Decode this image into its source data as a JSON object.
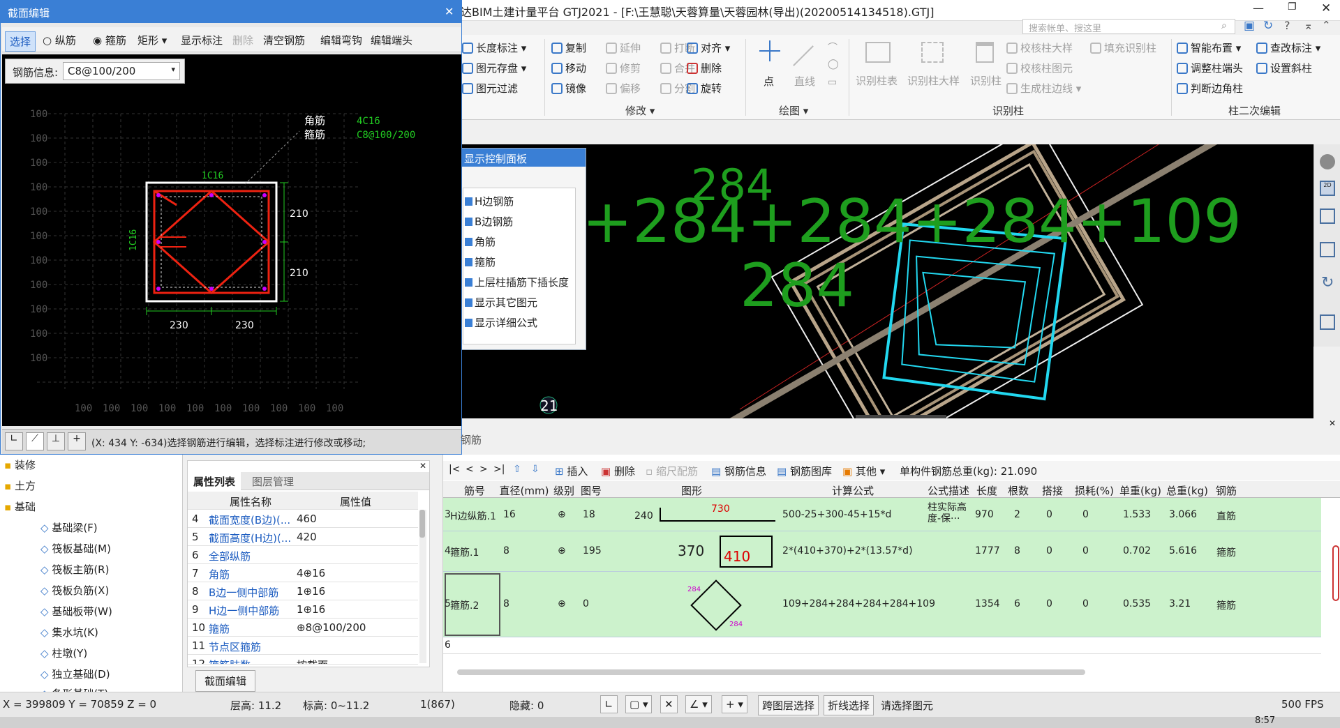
{
  "app": {
    "title": "达BIM土建计量平台 GTJ2021 - [F:\\王慧聪\\天蓉算量\\天蓉园林(导出)(20200514134518).GTJ]",
    "search_placeholder": "搜索帐单、搜这里"
  },
  "ribbon": {
    "col1": [
      "长度标注",
      "图元存盘",
      "图元过滤"
    ],
    "col2": [
      "复制",
      "移动",
      "镜像"
    ],
    "col3": [
      "延伸",
      "修剪",
      "偏移"
    ],
    "col4": [
      "打断",
      "合并",
      "分割"
    ],
    "col5": [
      "对齐",
      "删除",
      "旋转"
    ],
    "modify_group": "修改",
    "draw_items": [
      "点",
      "直线"
    ],
    "draw_group": "绘图",
    "recognize_items": [
      "识别柱表",
      "识别柱大样",
      "识别柱"
    ],
    "recognize_small": [
      "校核柱大样",
      "填充识别柱",
      "校核柱图元",
      "生成柱边线"
    ],
    "recognize_group": "识别柱",
    "secondary": [
      "智能布置",
      "查改标注",
      "调整柱端头",
      "设置斜柱",
      "判断边角柱"
    ],
    "secondary_group": "柱二次编辑"
  },
  "display_panel": {
    "title": "显示控制面板",
    "options": [
      "H边钢筋",
      "B边钢筋",
      "角筋",
      "箍筋",
      "上层柱插筋下插长度",
      "显示其它图元",
      "显示详细公式"
    ]
  },
  "view3d": {
    "labels": [
      "284+284+284+284+109",
      "284",
      "284",
      "21"
    ]
  },
  "section_editor": {
    "title": "截面编辑",
    "toolbar": [
      "选择",
      "纵筋",
      "箍筋",
      "矩形",
      "显示标注",
      "删除",
      "清空钢筋",
      "编辑弯钩",
      "编辑端头"
    ],
    "rebar_info_label": "钢筋信息:",
    "rebar_info_value": "C8@100/200",
    "grid_label": "100",
    "annotations": {
      "corner": "角筋",
      "stirrup": "箍筋",
      "corner_spec": "4C16",
      "stirrup_spec": "C8@100/200",
      "top_bar": "1C16",
      "side_bar": "1C16",
      "dim_h1": "210",
      "dim_h2": "210",
      "dim_b1": "230",
      "dim_b2": "230"
    },
    "status": "(X: 434 Y: -634)选择钢筋进行编辑，选择标注进行修改或移动;"
  },
  "tree": {
    "items": [
      "装修",
      "土方",
      "基础",
      "基础梁(F)",
      "筏板基础(M)",
      "筏板主筋(R)",
      "筏板负筋(X)",
      "基础板带(W)",
      "集水坑(K)",
      "柱墩(Y)",
      "独立基础(D)",
      "条形基础(T)"
    ]
  },
  "props": {
    "tabs": [
      "属性列表",
      "图层管理"
    ],
    "headers": [
      "属性名称",
      "属性值"
    ],
    "rows": [
      {
        "n": "4",
        "name": "截面宽度(B边)(...",
        "value": "460"
      },
      {
        "n": "5",
        "name": "截面高度(H边)(...",
        "value": "420"
      },
      {
        "n": "6",
        "name": "全部纵筋",
        "value": ""
      },
      {
        "n": "7",
        "name": "角筋",
        "value": "4⊕16"
      },
      {
        "n": "8",
        "name": "B边一侧中部筋",
        "value": "1⊕16"
      },
      {
        "n": "9",
        "name": "H边一侧中部筋",
        "value": "1⊕16"
      },
      {
        "n": "10",
        "name": "箍筋",
        "value": "⊕8@100/200"
      },
      {
        "n": "11",
        "name": "节点区箍筋",
        "value": ""
      },
      {
        "n": "12",
        "name": "箍筋肢数",
        "value": "按截面"
      }
    ],
    "button": "截面编辑"
  },
  "rebar": {
    "panel_title": "钢筋",
    "toolbar": [
      "插入",
      "删除",
      "缩尺配筋",
      "钢筋信息",
      "钢筋图库",
      "其他"
    ],
    "total": "单构件钢筋总重(kg): 21.090",
    "headers": [
      "筋号",
      "直径(mm)",
      "级别",
      "图号",
      "图形",
      "计算公式",
      "公式描述",
      "长度",
      "根数",
      "搭接",
      "损耗(%)",
      "单重(kg)",
      "总重(kg)",
      "钢筋"
    ],
    "rows": [
      {
        "idx": "3",
        "name": "H边纵筋.1",
        "dia": "16",
        "grade": "⊕",
        "fig": "18",
        "shape_a": "240",
        "shape_b": "730",
        "formula": "500-25+300-45+15*d",
        "desc": "柱实际高度-保···",
        "len": "970",
        "count": "2",
        "lap": "0",
        "loss": "0",
        "unit": "1.533",
        "total": "3.066",
        "type": "直筋"
      },
      {
        "idx": "4",
        "name": "箍筋.1",
        "dia": "8",
        "grade": "⊕",
        "fig": "195",
        "shape_a": "370",
        "shape_b": "410",
        "formula": "2*(410+370)+2*(13.57*d)",
        "desc": "",
        "len": "1777",
        "count": "8",
        "lap": "0",
        "loss": "0",
        "unit": "0.702",
        "total": "5.616",
        "type": "箍筋"
      },
      {
        "idx": "5",
        "name": "箍筋.2",
        "dia": "8",
        "grade": "⊕",
        "fig": "0",
        "shape_a": "284",
        "shape_b": "284",
        "formula": "109+284+284+284+284+109",
        "desc": "",
        "len": "1354",
        "count": "6",
        "lap": "0",
        "loss": "0",
        "unit": "0.535",
        "total": "3.21",
        "type": "箍筋"
      }
    ],
    "empty_idx": "6"
  },
  "status": {
    "coords": "X = 399809 Y = 70859 Z = 0",
    "floor_h": "层高:  11.2",
    "elev": "标高:  0~11.2",
    "count": "1(867)",
    "hidden": "隐藏:  0",
    "btn1": "跨图层选择",
    "btn2": "折线选择",
    "hint": "请选择图元",
    "fps": "500 FPS",
    "time": "8:57"
  }
}
